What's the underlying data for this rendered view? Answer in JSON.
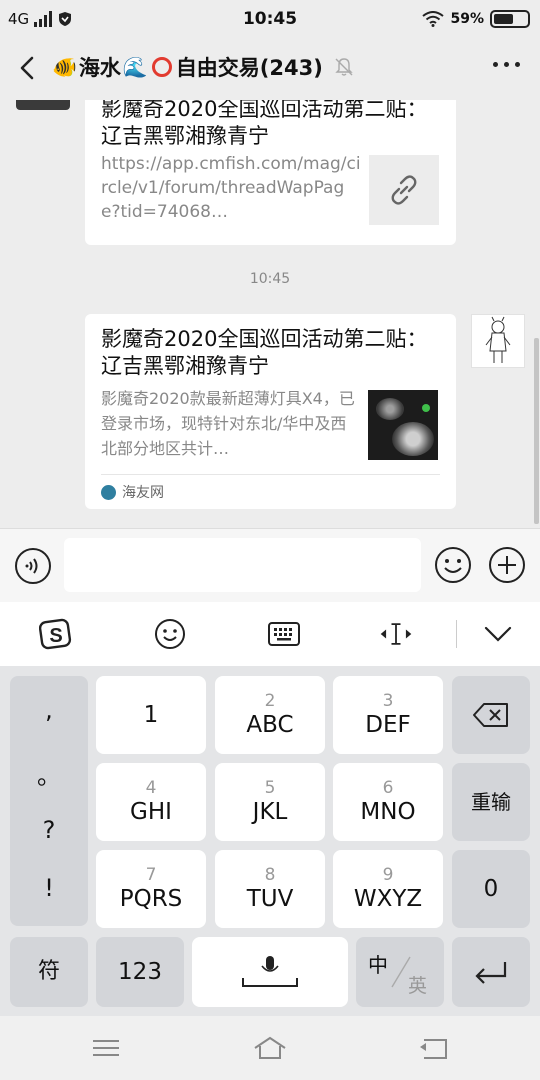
{
  "status": {
    "network": "4G",
    "time": "10:45",
    "battery": "59%",
    "battery_level": 0.59
  },
  "header": {
    "title_prefix_emoji": "🐠",
    "title_part1": "海水",
    "title_wave_emoji": "🌊",
    "title_part2": "自由交易(243)"
  },
  "messages": {
    "link_card": {
      "title": "影魔奇2020全国巡回活动第二贴：辽吉黑鄂湘豫青宁",
      "url": "https://app.cmfish.com/mag/circle/v1/forum/threadWapPage?tid=74068…"
    },
    "timestamp": "10:45",
    "article_card": {
      "title": "影魔奇2020全国巡回活动第二贴：辽吉黑鄂湘豫青宁",
      "description": "影魔奇2020款最新超薄灯具X4，已登录市场，现特针对东北/华中及西北部分地区共计…",
      "source": "海友网"
    }
  },
  "input": {
    "value": "",
    "placeholder": ""
  },
  "keyboard": {
    "punctuation": [
      ",",
      "。",
      "?",
      "!"
    ],
    "keys": [
      {
        "num": "",
        "label": "1"
      },
      {
        "num": "2",
        "label": "ABC"
      },
      {
        "num": "3",
        "label": "DEF"
      },
      {
        "num": "4",
        "label": "GHI"
      },
      {
        "num": "5",
        "label": "JKL"
      },
      {
        "num": "6",
        "label": "MNO"
      },
      {
        "num": "7",
        "label": "PQRS"
      },
      {
        "num": "8",
        "label": "TUV"
      },
      {
        "num": "9",
        "label": "WXYZ"
      }
    ],
    "retype_label": "重输",
    "zero_label": "0",
    "symbol_label": "符",
    "num123_label": "123",
    "zh_label": "中",
    "en_label": "英"
  }
}
